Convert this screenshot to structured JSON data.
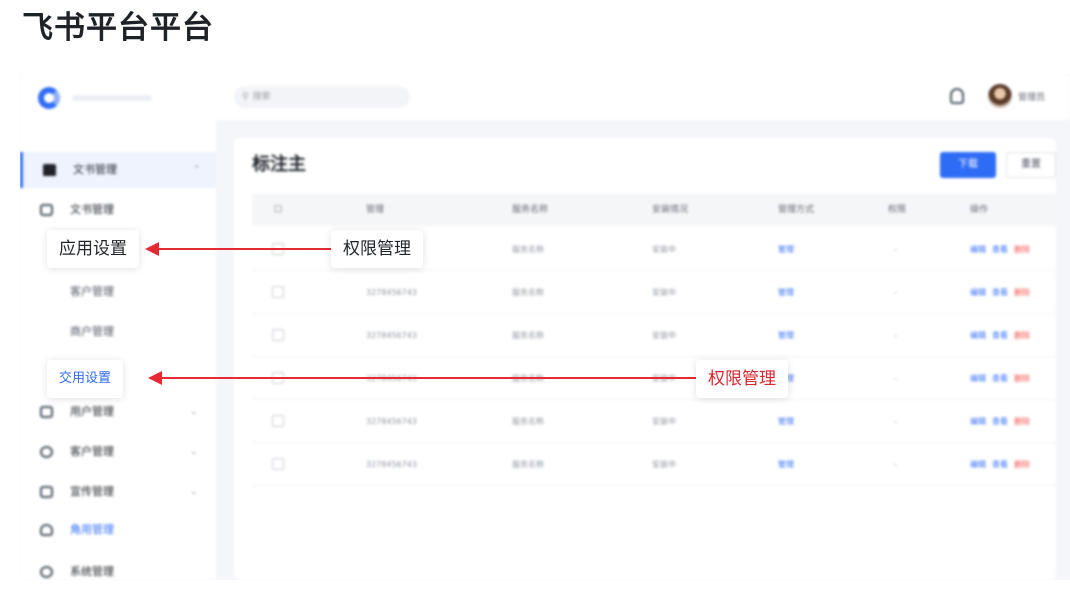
{
  "page_title": "飞书平台平台",
  "header": {
    "search_placeholder": "搜索",
    "user_name": "管理员"
  },
  "sidebar": {
    "items": [
      {
        "label": "文书管理",
        "active": true
      },
      {
        "label": "文书管理"
      },
      {
        "label": "客户管理"
      },
      {
        "label": "商户管理"
      },
      {
        "label": "交用设置"
      },
      {
        "label": "用户管理"
      },
      {
        "label": "客户管理"
      },
      {
        "label": "宣传管理"
      },
      {
        "label": "角用管理"
      },
      {
        "label": "系统管理"
      }
    ]
  },
  "main": {
    "title": "标注主",
    "primary_button": "下载",
    "secondary_button": "重置",
    "columns": [
      "管理",
      "服务名称",
      "安装情况",
      "管理方式",
      "权限",
      "操作"
    ],
    "rows": [
      {
        "id": "3278456743",
        "name": "服务名称",
        "status": "安装中",
        "method": "管理",
        "perm": "-"
      },
      {
        "id": "3278456743",
        "name": "服务名称",
        "status": "安装中",
        "method": "管理",
        "perm": "-"
      },
      {
        "id": "3278456743",
        "name": "服务名称",
        "status": "安装中",
        "method": "管理",
        "perm": "-"
      },
      {
        "id": "3278456743",
        "name": "服务名称",
        "status": "安装中",
        "method": "管理",
        "perm": "-"
      },
      {
        "id": "3278456743",
        "name": "服务名称",
        "status": "安装中",
        "method": "管理",
        "perm": "-"
      },
      {
        "id": "3278456743",
        "name": "服务名称",
        "status": "安装中",
        "method": "管理",
        "perm": "-"
      }
    ],
    "actions": [
      "编辑",
      "查看",
      "删除"
    ]
  },
  "annotations": {
    "top_left": "应用设置",
    "top_right": "权限管理",
    "bottom_left": "交用设置",
    "bottom_right": "权限管理"
  },
  "colors": {
    "accent": "#2f6cf6",
    "arrow": "#e52a33",
    "danger": "#f54a45"
  }
}
